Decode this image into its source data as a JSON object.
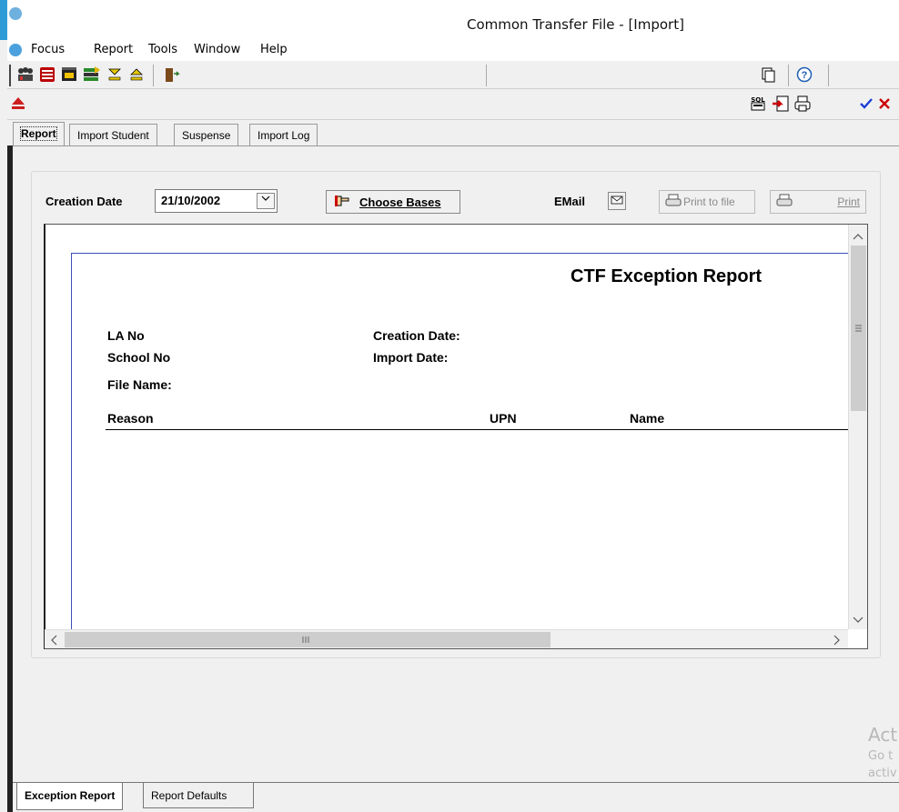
{
  "window": {
    "title": "Common Transfer File - [Import]"
  },
  "menu": [
    "Focus",
    "Report",
    "Tools",
    "Window",
    "Help"
  ],
  "tabs": [
    "Report",
    "Import Student",
    "Suspense",
    "Import Log"
  ],
  "form": {
    "creation_date_label": "Creation Date",
    "creation_date_value": "21/10/2002",
    "choose_bases_label": "Choose Bases",
    "email_label": "EMail",
    "print_to_file_label": "Print to file",
    "print_label": "Print"
  },
  "report": {
    "title": "CTF Exception Report",
    "la_no": "LA No",
    "school_no": "School No",
    "file_name": "File Name:",
    "creation_date": "Creation Date:",
    "import_date": "Import Date:",
    "columns": [
      "Reason",
      "UPN",
      "Name"
    ]
  },
  "bottom_tabs": [
    "Exception Report",
    "Report Defaults"
  ],
  "toolbar": {
    "sql_label": "SQL"
  },
  "watermark": [
    "Act",
    "Go t",
    "activ"
  ],
  "colors": {
    "title_accent": "#2e9bd6",
    "report_border": "#3b4fb5",
    "check_green": "#1a3fd6",
    "cancel_red": "#cc0000"
  }
}
